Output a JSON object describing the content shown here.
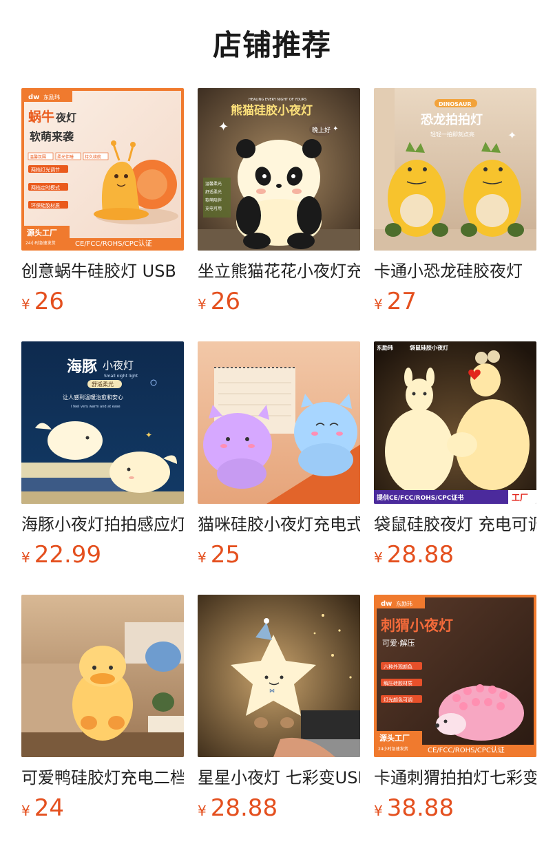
{
  "page": {
    "title": "店铺推荐"
  },
  "products": [
    {
      "name": "创意蜗牛硅胶灯 USB",
      "currency": "¥",
      "price": "26",
      "image": {
        "icon": "snail-lamp-image",
        "brand": "东励玮",
        "headline1": "蜗牛",
        "headline1b": "夜灯",
        "headline2": "软萌来袭",
        "tags": [
          "温馨氛围",
          "柔光伴睡",
          "持久续航"
        ],
        "features": [
          "两档灯光调节",
          "两档定时模式",
          "环保硅胶材质"
        ],
        "corner": "源头工厂",
        "corner_sub": "24小时急速发货",
        "cert": "CE/FCC/ROHS/CPC认证"
      }
    },
    {
      "name": "坐立熊猫花花小夜灯充电",
      "currency": "¥",
      "price": "26",
      "image": {
        "icon": "panda-lamp-image",
        "tagline": "HEALING EVERY NIGHT OF YOURS",
        "headline": "熊猫硅胶小夜灯",
        "bubble": "晚上好",
        "features": [
          "温馨柔光",
          "舒适柔光",
          "软萌陪伴",
          "充电可用"
        ]
      }
    },
    {
      "name": "卡通小恐龙硅胶夜灯",
      "currency": "¥",
      "price": "27",
      "image": {
        "icon": "dinosaur-lamp-image",
        "tagline": "DINOSAUR",
        "headline": "恐龙拍拍灯",
        "sub": "轻轻一拍即刻点亮"
      }
    },
    {
      "name": "海豚小夜灯拍拍感应灯",
      "currency": "¥",
      "price": "22.99",
      "image": {
        "icon": "dolphin-lamp-image",
        "headline": "海豚",
        "headline_small": "小夜灯",
        "headline_en": "Small night light",
        "pill": "舒适柔光",
        "sub": "让人感到温暖治愈和安心",
        "sub_en": "I feel very warm and at ease"
      }
    },
    {
      "name": "猫咪硅胶小夜灯充电式",
      "currency": "¥",
      "price": "25",
      "image": {
        "icon": "cat-lamp-image"
      }
    },
    {
      "name": "袋鼠硅胶夜灯 充电可调",
      "currency": "¥",
      "price": "28.88",
      "image": {
        "icon": "kangaroo-lamp-image",
        "brand": "东励玮",
        "headline": "袋鼠硅胶小夜灯",
        "cert": "提供CE/FCC/ROHS/CPC证书",
        "corner": "工厂"
      }
    },
    {
      "name": "可爱鸭硅胶灯充电二档",
      "currency": "¥",
      "price": "24",
      "image": {
        "icon": "duck-lamp-image"
      }
    },
    {
      "name": "星星小夜灯 七彩变USB",
      "currency": "¥",
      "price": "28.88",
      "image": {
        "icon": "star-lamp-image"
      }
    },
    {
      "name": "卡通刺猬拍拍灯七彩变色",
      "currency": "¥",
      "price": "38.88",
      "image": {
        "icon": "hedgehog-lamp-image",
        "brand": "东励玮",
        "headline": "刺猬小夜灯",
        "sub": "可爱·解压",
        "features": [
          "六种外观颜色",
          "解压硅胶材质",
          "灯光颜色可调"
        ],
        "corner": "源头工厂",
        "corner_sub": "24小时急速发货",
        "cert": "CE/FCC/ROHS/CPC认证"
      }
    }
  ],
  "colors": {
    "price": "#e4501f",
    "brand_orange": "#f07a2e"
  }
}
